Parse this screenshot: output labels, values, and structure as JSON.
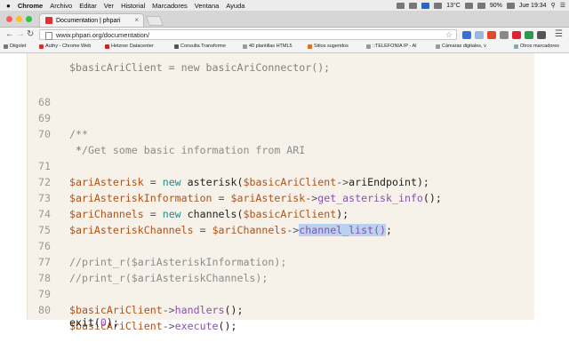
{
  "menubar": {
    "apple": "",
    "items": [
      "Chrome",
      "Archivo",
      "Editar",
      "Ver",
      "Historial",
      "Marcadores",
      "Ventana",
      "Ayuda"
    ],
    "status": {
      "temperature": "13°C",
      "battery": "90%",
      "clock": "Jue 19:34"
    }
  },
  "tab": {
    "title": "Documentation | phpari"
  },
  "toolbar": {
    "back_icon": "back-arrow-icon",
    "forward_icon": "forward-arrow-icon",
    "reload_icon": "reload-icon",
    "url": "www.phpari.org/documentation/"
  },
  "bookmarks": {
    "items": [
      "Diigolet",
      "Authy - Chrome Web",
      "Hetzner Datacenter",
      "Consulta Transforme",
      "40 plantillas HTML5",
      "Sitios sugeridos",
      "::TELEFONIA IP - Al",
      "Cámaras digitales, v",
      "Otros marcadores"
    ]
  },
  "colors": {
    "editor_background": "#f6f2ea",
    "variable": "#b0511a",
    "keyword": "#248a8a",
    "method": "#8a4fb0",
    "comment": "#8c8c8c",
    "selection": "#b9d3ee"
  },
  "editor": {
    "top_partial": "$basicAriClient = new basicAriConnector();",
    "lines": {
      "l68": {
        "num": "68",
        "text": ""
      },
      "l69": {
        "num": "69",
        "text": "/**"
      },
      "l70": {
        "num": "70",
        "text": " * Get some basic information from ARI"
      },
      "l70b": {
        "num": "",
        "text": " */"
      },
      "l71": {
        "num": "71",
        "var": "$ariAsterisk",
        "eq": " = ",
        "kw": "new",
        "fn": " asterisk(",
        "arg": "$basicAriClient",
        "arrow": "->",
        "prop": "ariEndpoint",
        "end": ");"
      },
      "l72": {
        "num": "72",
        "var": "$ariAsteriskInformation",
        "eq": " = ",
        "obj": "$ariAsterisk",
        "arrow": "->",
        "method": "get_asterisk_info",
        "end": "();"
      },
      "l73": {
        "num": "73",
        "var": "$ariChannels",
        "eq": " = ",
        "kw": "new",
        "fn": " channels(",
        "arg": "$basicAriClient",
        "end": ");"
      },
      "l74": {
        "num": "74",
        "var": "$ariAsteriskChannels",
        "eq": " = ",
        "obj": "$ariChannels",
        "arrow": "->",
        "method": "channel_list",
        "paren": "()",
        "end": ";"
      },
      "l75": {
        "num": "75",
        "text": ""
      },
      "l76": {
        "num": "76",
        "text": "//print_r($ariAsteriskInformation);"
      },
      "l77": {
        "num": "77",
        "text": "//print_r($ariAsteriskChannels);"
      },
      "l78": {
        "num": "78",
        "text": ""
      },
      "l79": {
        "num": "79",
        "obj": "$basicAriClient",
        "arrow": "->",
        "method": "handlers",
        "end": "();"
      },
      "l80": {
        "num": "80",
        "obj": "$basicAriClient",
        "arrow": "->",
        "method": "execute",
        "end": "();"
      },
      "exit": {
        "fn": "exit(",
        "arg": "0",
        "end": ");"
      }
    }
  }
}
